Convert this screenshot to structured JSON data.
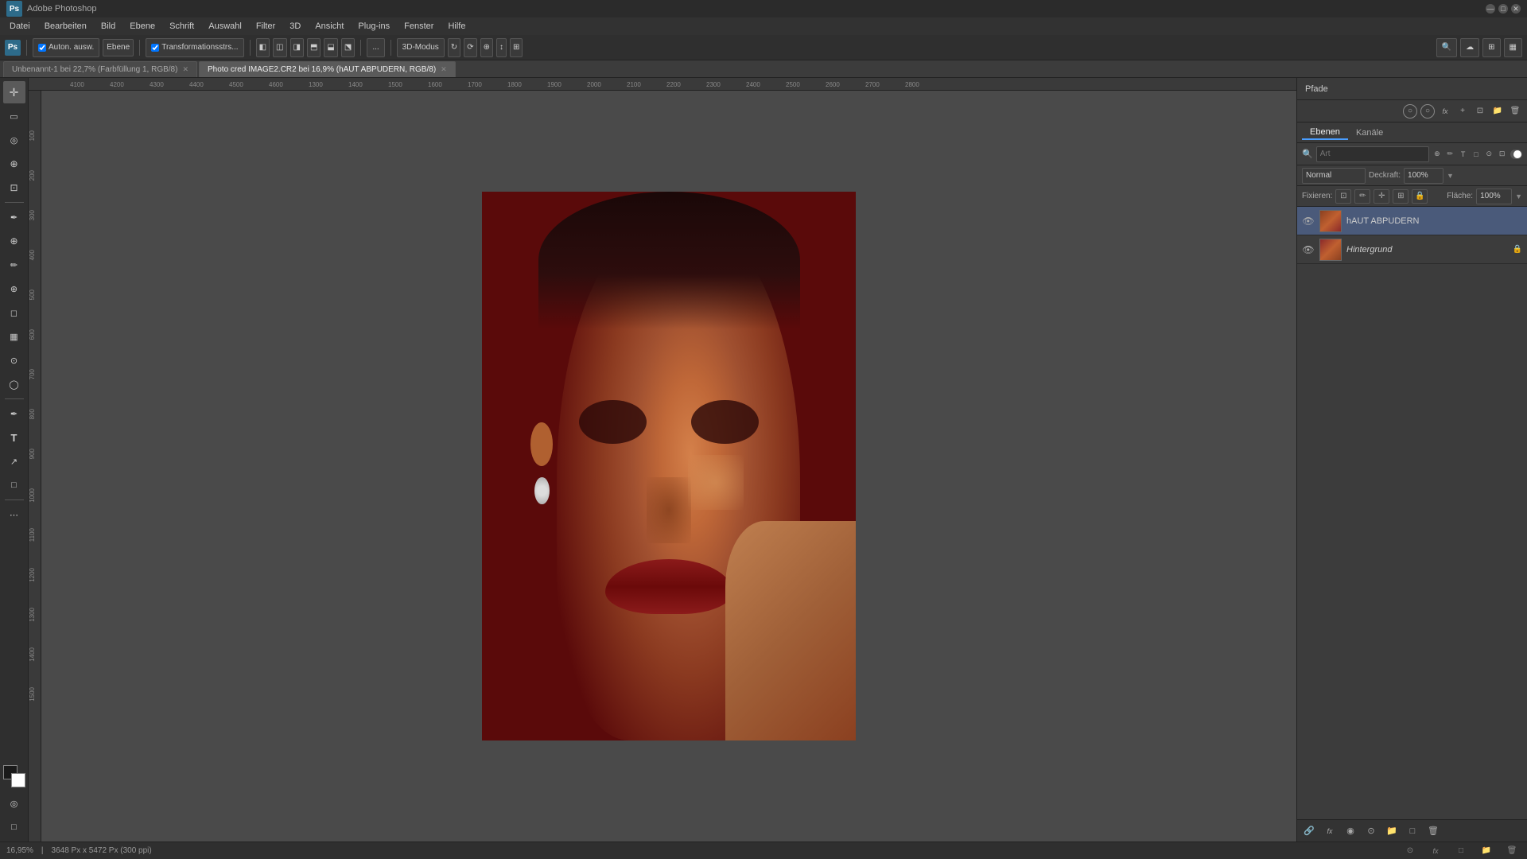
{
  "app": {
    "title": "Adobe Photoshop",
    "logo": "Ps"
  },
  "titlebar": {
    "title": "Adobe Photoshop",
    "minimize": "—",
    "maximize": "□",
    "close": "✕"
  },
  "menubar": {
    "items": [
      "Datei",
      "Bearbeiten",
      "Bild",
      "Ebene",
      "Schrift",
      "Auswahl",
      "Filter",
      "3D",
      "Ansicht",
      "Plug-ins",
      "Fenster",
      "Hilfe"
    ]
  },
  "toolbar": {
    "home_icon": "⌂",
    "tool_icon": "✦",
    "auto_label": "Auton. ausw.",
    "ebene_label": "Ebene",
    "transform_label": "Transformationsstrs...",
    "mode_label": "3D-Modus",
    "more_label": "..."
  },
  "tabs": [
    {
      "id": "tab1",
      "label": "Unbenannt-1 bei 22,7% (Farbfüllung 1, RGB/8)",
      "active": false,
      "closable": true
    },
    {
      "id": "tab2",
      "label": "Photo cred IMAGE2.CR2 bei 16,9% (hAUT ABPUDERN, RGB/8)",
      "active": true,
      "closable": true
    }
  ],
  "tools": {
    "items": [
      {
        "name": "move",
        "icon": "✛"
      },
      {
        "name": "marquee",
        "icon": "▭"
      },
      {
        "name": "lasso",
        "icon": "⌖"
      },
      {
        "name": "quick-select",
        "icon": "⊕"
      },
      {
        "name": "crop",
        "icon": "⊡"
      },
      {
        "name": "eyedropper",
        "icon": "✒"
      },
      {
        "name": "healing",
        "icon": "⊕"
      },
      {
        "name": "brush",
        "icon": "✏"
      },
      {
        "name": "clone",
        "icon": "⊕"
      },
      {
        "name": "eraser",
        "icon": "◻"
      },
      {
        "name": "gradient",
        "icon": "▦"
      },
      {
        "name": "blur",
        "icon": "⊙"
      },
      {
        "name": "dodge",
        "icon": "◯"
      },
      {
        "name": "pen",
        "icon": "✒"
      },
      {
        "name": "text",
        "icon": "T"
      },
      {
        "name": "path-select",
        "icon": "↗"
      },
      {
        "name": "shape",
        "icon": "□"
      },
      {
        "name": "more",
        "icon": "⋯"
      },
      {
        "name": "hand",
        "icon": "✋"
      },
      {
        "name": "zoom",
        "icon": "🔍"
      }
    ]
  },
  "right_panel": {
    "paths_title": "Pfade",
    "layer_tabs": [
      "Ebenen",
      "Kanäle"
    ],
    "active_layer_tab": "Ebenen",
    "filter_placeholder": "Art",
    "blend_mode": "Normal",
    "opacity_label": "Deckraft:",
    "opacity_value": "100%",
    "fill_label": "Fläche:",
    "fill_value": "100%",
    "lock_label": "Fixieren:",
    "layers": [
      {
        "id": "layer1",
        "name": "hAUT ABPUDERN",
        "visible": true,
        "active": true,
        "has_thumb": true,
        "thumb_class": "thumb-haut"
      },
      {
        "id": "layer2",
        "name": "Hintergrund",
        "visible": true,
        "active": false,
        "has_thumb": true,
        "thumb_class": "thumb-bg",
        "locked": true
      }
    ],
    "bottom_icons": [
      "fx",
      "◉",
      "□",
      "📁",
      "🗑"
    ]
  },
  "statusbar": {
    "zoom": "16,95%",
    "dimensions": "3648 Px x 5472 Px (300 ppi)",
    "info": ""
  }
}
